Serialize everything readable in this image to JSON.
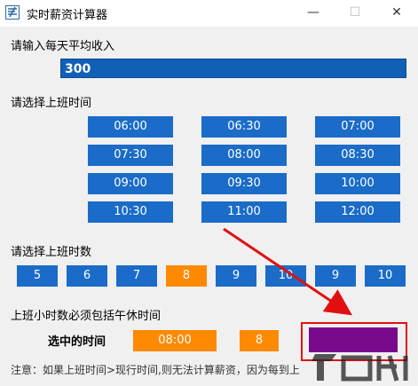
{
  "window": {
    "title": "实时薪资计算器",
    "minimize_glyph": "—",
    "maximize_glyph": "☐",
    "close_glyph": "✕"
  },
  "income": {
    "label": "请输入每天平均收入",
    "value": "300"
  },
  "start_time": {
    "label": "请选择上班时间",
    "options": [
      "06:00",
      "06:30",
      "07:00",
      "07:30",
      "08:00",
      "08:30",
      "09:00",
      "09:30",
      "10:00",
      "10:30",
      "11:00",
      "12:00"
    ]
  },
  "hours": {
    "label": "请选择上班时数",
    "options": [
      "5",
      "6",
      "7",
      "8",
      "9",
      "10",
      "9",
      "10"
    ],
    "selected_index": 3
  },
  "hint": "上班小时数必须包括午休时间",
  "selection": {
    "label": "选中的时间",
    "time": "08:00",
    "hours": "8"
  },
  "note": "注意：如果上班时间>现行时间,则无法计算薪资，因为每到上",
  "colors": {
    "button_blue": "#1a6cc8",
    "selected_orange": "#ff8a00",
    "action_purple": "#7a0a8c",
    "annotation_red": "#e01010"
  }
}
